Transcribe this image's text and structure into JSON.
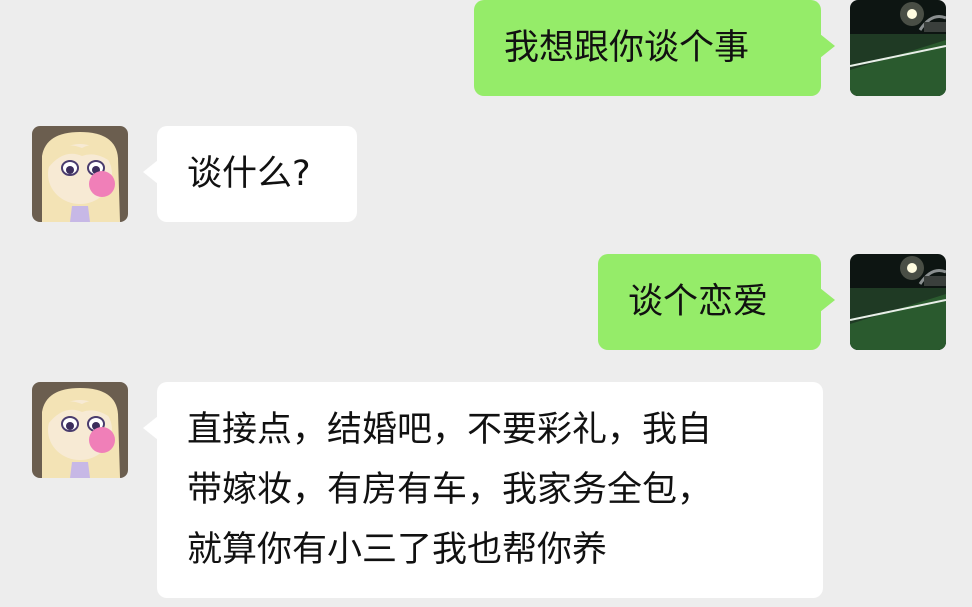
{
  "chat": {
    "messages": [
      {
        "sender": "me",
        "text": "我想跟你谈个事"
      },
      {
        "sender": "other",
        "text": "谈什么?"
      },
      {
        "sender": "me",
        "text": "谈个恋爱"
      },
      {
        "sender": "other",
        "text": "直接点，结婚吧，不要彩礼，我自\n带嫁妆，有房有车，我家务全包，\n就算你有小三了我也帮你养"
      }
    ]
  },
  "avatars": {
    "me": "stadium-night-photo",
    "other": "cartoon-girl-blowing-bubblegum"
  },
  "colors": {
    "background": "#ededed",
    "my_bubble": "#95ec69",
    "their_bubble": "#ffffff"
  }
}
